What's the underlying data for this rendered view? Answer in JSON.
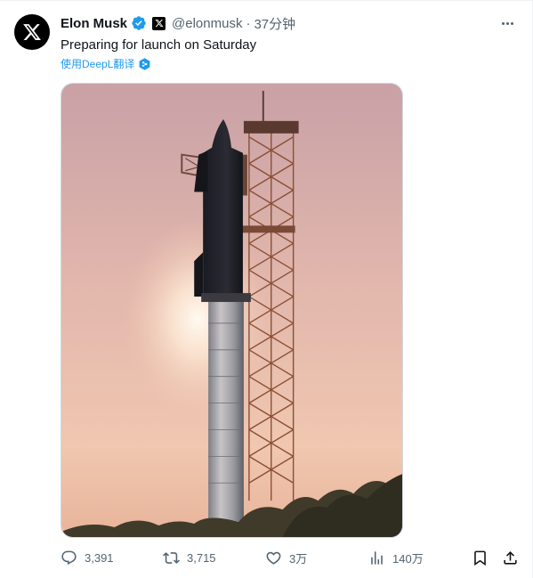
{
  "tweet": {
    "author_name": "Elon Musk",
    "handle": "@elonmusk",
    "separator": "·",
    "time": "37分钟",
    "text": "Preparing for launch on Saturday",
    "translate_label": "使用DeepL翻译"
  },
  "actions": {
    "replies": "3,391",
    "retweets": "3,715",
    "likes": "3万",
    "views": "140万"
  },
  "colors": {
    "accent": "#1d9bf0",
    "muted": "#536471",
    "text": "#0f1419",
    "verified": "#1d9bf0"
  },
  "icons": [
    "x-logo-icon",
    "verified-badge-icon",
    "x-affiliate-icon",
    "more-icon",
    "deepl-icon",
    "reply-icon",
    "retweet-icon",
    "like-icon",
    "views-icon",
    "bookmark-icon",
    "share-icon"
  ]
}
